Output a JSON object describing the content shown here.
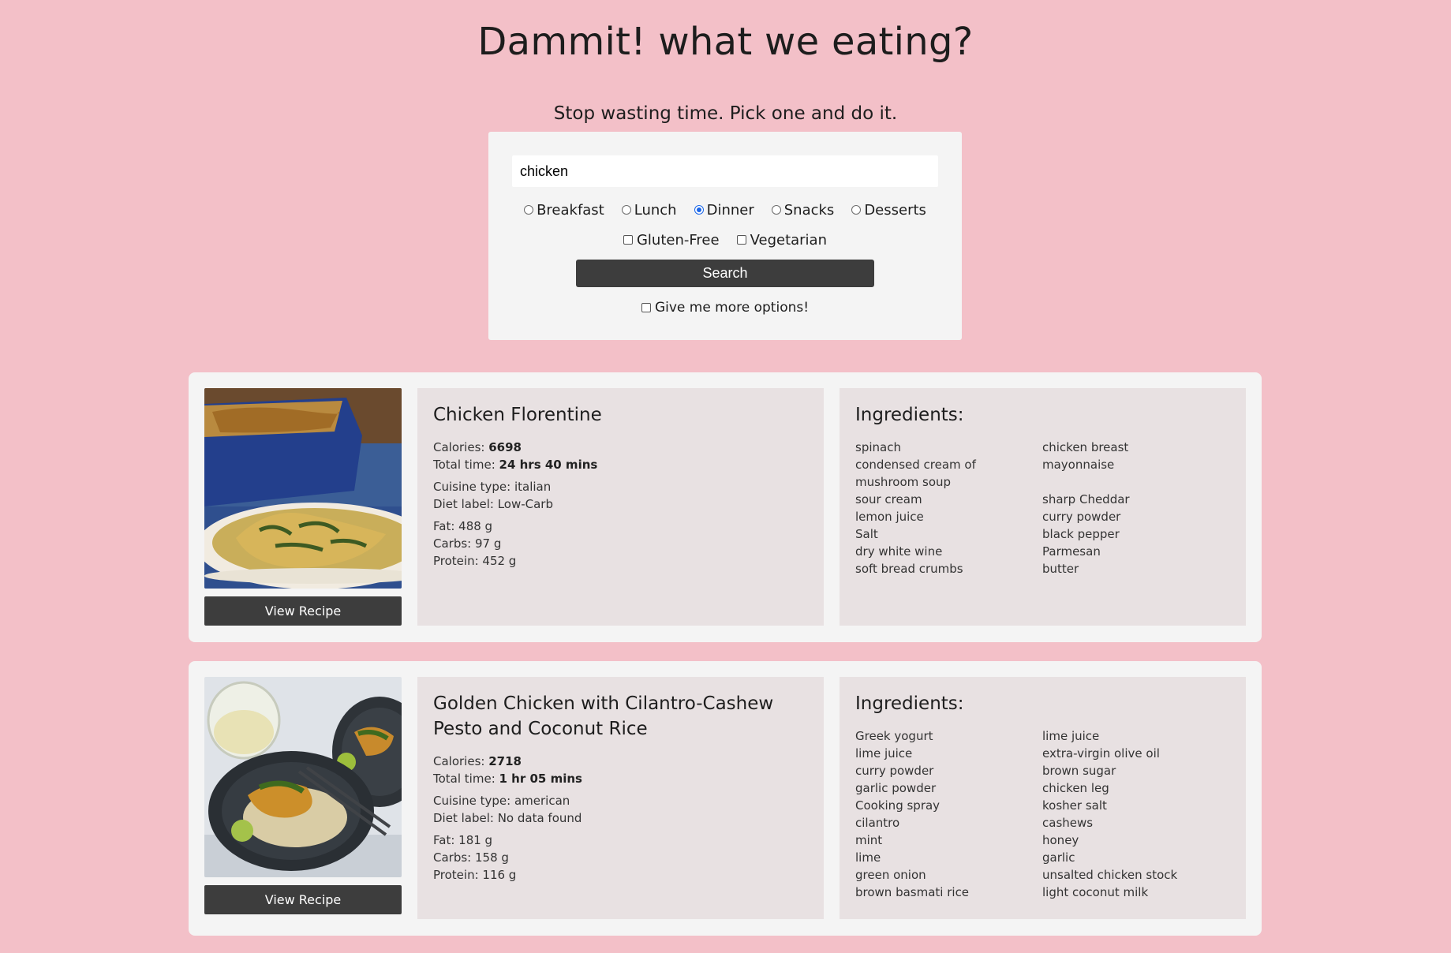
{
  "header": {
    "title": "Dammit! what we eating?",
    "tagline": "Stop wasting time. Pick one and do it."
  },
  "search": {
    "value": "chicken",
    "meal_types": [
      {
        "label": "Breakfast",
        "checked": false
      },
      {
        "label": "Lunch",
        "checked": false
      },
      {
        "label": "Dinner",
        "checked": true
      },
      {
        "label": "Snacks",
        "checked": false
      },
      {
        "label": "Desserts",
        "checked": false
      }
    ],
    "diets": [
      {
        "label": "Gluten-Free",
        "checked": false
      },
      {
        "label": "Vegetarian",
        "checked": false
      }
    ],
    "button_label": "Search",
    "more_options_label": "Give me more options!"
  },
  "recipes": [
    {
      "title": "Chicken Florentine",
      "calories_label": "Calories: ",
      "calories": "6698",
      "time_label": "Total time: ",
      "time": "24 hrs 40 mins",
      "cuisine": "Cuisine type: italian",
      "diet": "Diet label: Low-Carb",
      "fat": "Fat: 488 g",
      "carbs": "Carbs: 97 g",
      "protein": "Protein: 452 g",
      "view_label": "View Recipe",
      "ingredients_title": "Ingredients:",
      "ingredients": [
        "spinach",
        "chicken breast",
        "condensed cream of mushroom soup",
        "mayonnaise",
        "sour cream",
        "sharp Cheddar",
        "lemon juice",
        "curry powder",
        "Salt",
        "black pepper",
        "dry white wine",
        "Parmesan",
        "soft bread crumbs",
        "butter"
      ]
    },
    {
      "title": "Golden Chicken with Cilantro-Cashew Pesto and Coconut Rice",
      "calories_label": "Calories: ",
      "calories": "2718",
      "time_label": "Total time: ",
      "time": "1 hr 05 mins",
      "cuisine": "Cuisine type: american",
      "diet": "Diet label: No data found",
      "fat": "Fat: 181 g",
      "carbs": "Carbs: 158 g",
      "protein": "Protein: 116 g",
      "view_label": "View Recipe",
      "ingredients_title": "Ingredients:",
      "ingredients": [
        "Greek yogurt",
        "lime juice",
        "lime juice",
        "extra-virgin olive oil",
        "curry powder",
        "brown sugar",
        "garlic powder",
        "chicken leg",
        "Cooking spray",
        "kosher salt",
        "cilantro",
        "cashews",
        "mint",
        "honey",
        "lime",
        "garlic",
        "green onion",
        "unsalted chicken stock",
        "brown basmati rice",
        "light coconut milk"
      ]
    }
  ]
}
